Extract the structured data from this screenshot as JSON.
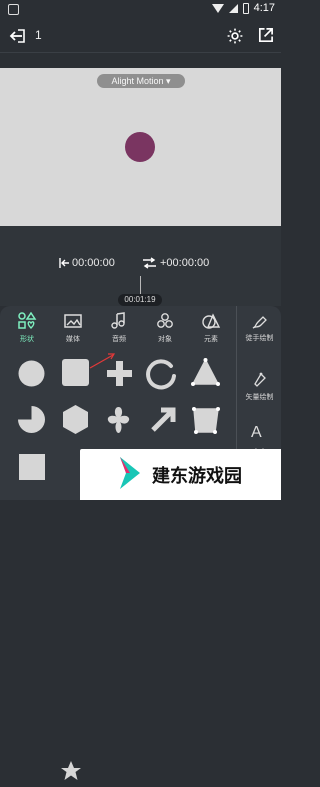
{
  "status_bar": {
    "time": "4:17"
  },
  "toolbar": {
    "project_title": "1"
  },
  "canvas": {
    "watermark": "Alight Motion ▾",
    "shape_color": "#7a3561"
  },
  "timeline": {
    "start_time": "00:00:00",
    "offset_time": "+00:00:00",
    "current_marker": "00:01:19"
  },
  "panel": {
    "tabs": [
      {
        "label": "形状"
      },
      {
        "label": "媒体"
      },
      {
        "label": "音频"
      },
      {
        "label": "对象"
      },
      {
        "label": "元素"
      }
    ],
    "side_tools": [
      {
        "label": "徒手绘制"
      },
      {
        "label": "矢量绘制"
      },
      {
        "label": "文本"
      }
    ]
  },
  "promo": {
    "text": "建东游戏园"
  }
}
